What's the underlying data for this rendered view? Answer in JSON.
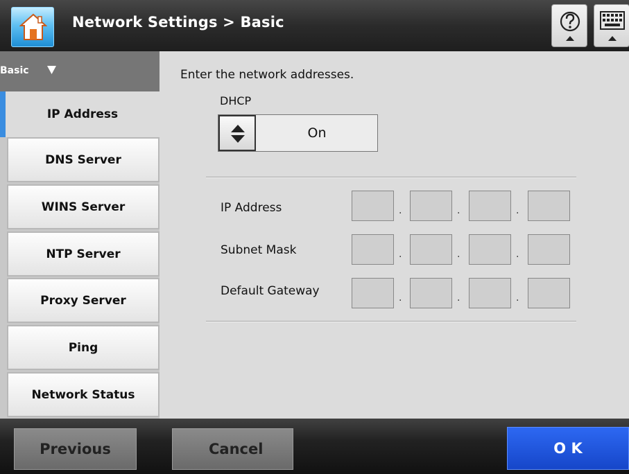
{
  "header": {
    "title": "Network Settings > Basic",
    "home_icon": "home-icon",
    "help_icon": "help-icon",
    "keyboard_icon": "keyboard-icon"
  },
  "sidebar": {
    "section_label": "Basic",
    "section_arrow": "▼",
    "items": [
      {
        "label": "IP Address",
        "active": true
      },
      {
        "label": "DNS Server",
        "active": false
      },
      {
        "label": "WINS Server",
        "active": false
      },
      {
        "label": "NTP Server",
        "active": false
      },
      {
        "label": "Proxy Server",
        "active": false
      },
      {
        "label": "Ping",
        "active": false
      },
      {
        "label": "Network Status",
        "active": false
      }
    ]
  },
  "main": {
    "instruction": "Enter the network addresses.",
    "dhcp": {
      "label": "DHCP",
      "value": "On"
    },
    "fields": [
      {
        "label": "IP Address",
        "octets": [
          "",
          "",
          "",
          ""
        ]
      },
      {
        "label": "Subnet Mask",
        "octets": [
          "",
          "",
          "",
          ""
        ]
      },
      {
        "label": "Default Gateway",
        "octets": [
          "",
          "",
          "",
          ""
        ]
      }
    ],
    "separator": "."
  },
  "footer": {
    "previous_label": "Previous",
    "cancel_label": "Cancel",
    "ok_label": "O K"
  },
  "colors": {
    "accent_blue": "#1f4fd8",
    "active_tab_marker": "#3a8de0",
    "home_button": "#3aa9ea"
  }
}
